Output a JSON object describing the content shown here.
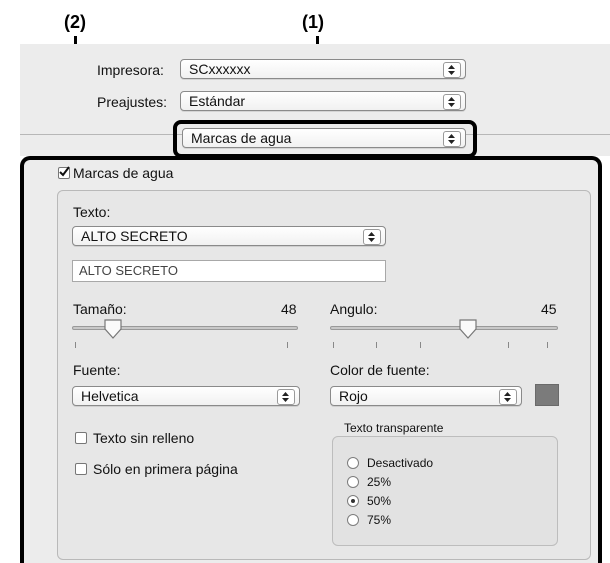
{
  "callouts": {
    "one": "(1)",
    "two": "(2)"
  },
  "top": {
    "printer_label": "Impresora:",
    "printer_value": "SCxxxxxx",
    "presets_label": "Preajustes:",
    "presets_value": "Estándar",
    "section_popup_value": "Marcas de agua"
  },
  "watermark": {
    "enable_label": "Marcas de agua",
    "enabled": true,
    "text_label": "Texto:",
    "text_popup_value": "ALTO SECRETO",
    "text_field_value": "ALTO SECRETO",
    "size_label": "Tamaño:",
    "size_value": "48",
    "angle_label": "Angulo:",
    "angle_value": "45",
    "font_label": "Fuente:",
    "font_value": "Helvetica",
    "font_color_label": "Color de fuente:",
    "font_color_value": "Rojo",
    "swatch_color": "#7b7b7b",
    "no_fill_label": "Texto sin relleno",
    "no_fill_checked": false,
    "first_page_label": "Sólo en primera página",
    "first_page_checked": false,
    "transparency_title": "Texto transparente",
    "transparency_options": [
      "Desactivado",
      "25%",
      "50%",
      "75%"
    ],
    "transparency_selected": "50%"
  }
}
